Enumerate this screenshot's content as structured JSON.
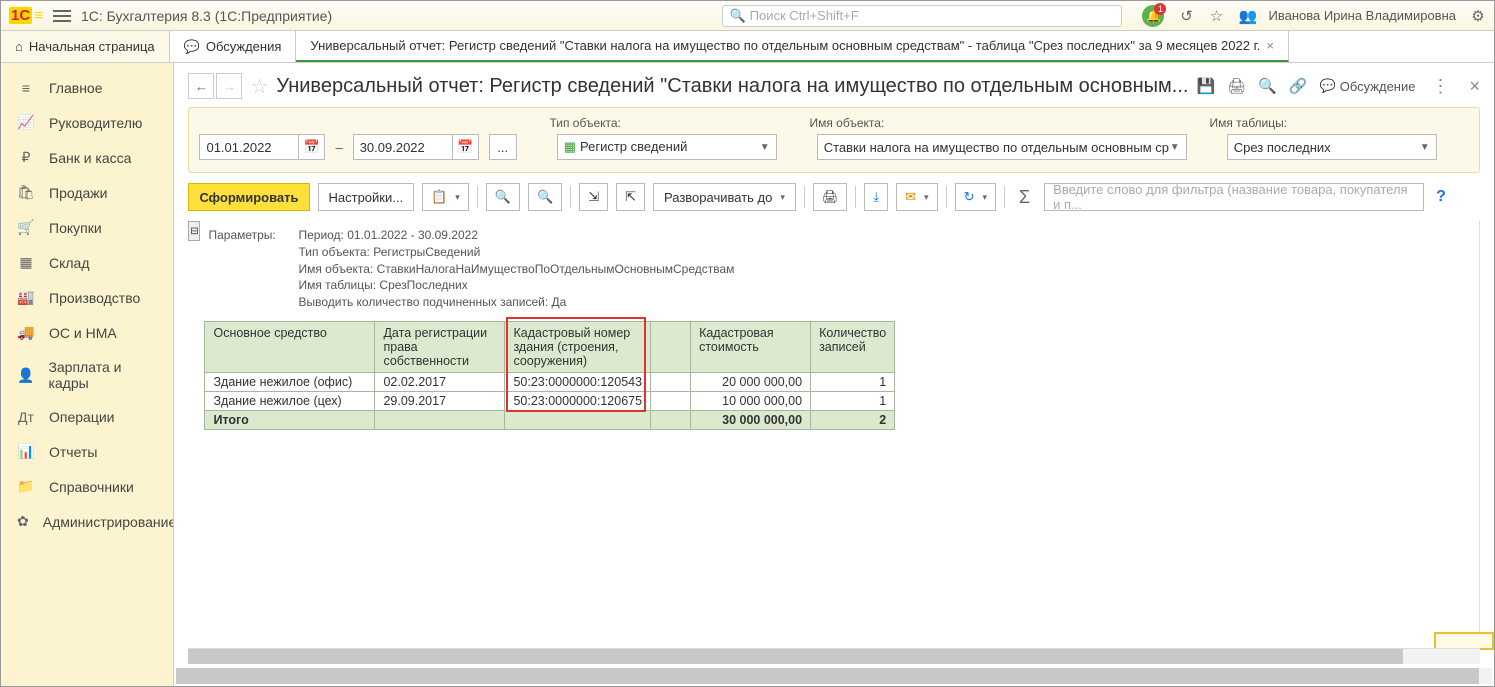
{
  "titlebar": {
    "app_title": "1С: Бухгалтерия 8.3  (1С:Предприятие)",
    "search_placeholder": "Поиск Ctrl+Shift+F",
    "bell_badge": "1",
    "user_name": "Иванова Ирина Владимировна"
  },
  "tabs": {
    "home": "Начальная страница",
    "discuss": "Обсуждения",
    "active": "Универсальный отчет: Регистр сведений \"Ставки налога на имущество по отдельным основным средствам\" - таблица \"Срез последних\" за 9 месяцев 2022 г."
  },
  "sidebar": [
    {
      "icon": "≡",
      "label": "Главное"
    },
    {
      "icon": "📈",
      "label": "Руководителю"
    },
    {
      "icon": "₽",
      "label": "Банк и касса"
    },
    {
      "icon": "🛍",
      "label": "Продажи"
    },
    {
      "icon": "🛒",
      "label": "Покупки"
    },
    {
      "icon": "▦",
      "label": "Склад"
    },
    {
      "icon": "🏭",
      "label": "Производство"
    },
    {
      "icon": "🚚",
      "label": "ОС и НМА"
    },
    {
      "icon": "👤",
      "label": "Зарплата и кадры"
    },
    {
      "icon": "Дт",
      "label": "Операции"
    },
    {
      "icon": "📊",
      "label": "Отчеты"
    },
    {
      "icon": "📁",
      "label": "Справочники"
    },
    {
      "icon": "✿",
      "label": "Администрирование"
    }
  ],
  "header": {
    "title": "Универсальный отчет: Регистр сведений \"Ставки налога на имущество по отдельным основным...",
    "discuss": "Обсуждение"
  },
  "filter": {
    "lbl_type": "Тип объекта:",
    "lbl_obj": "Имя объекта:",
    "lbl_tbl": "Имя таблицы:",
    "date_from": "01.01.2022",
    "date_to": "30.09.2022",
    "dash": "–",
    "dots": "...",
    "type_value": "Регистр сведений",
    "obj_value": "Ставки налога на имущество по отдельным основным ср",
    "tbl_value": "Срез последних"
  },
  "toolbar": {
    "form": "Сформировать",
    "settings": "Настройки...",
    "expand": "Разворачивать до",
    "filter_placeholder": "Введите слово для фильтра (название товара, покупателя и п...",
    "sigma": "Σ"
  },
  "params": {
    "label": "Параметры:",
    "period": "Период: 01.01.2022 - 30.09.2022",
    "type": "Тип объекта: РегистрыСведений",
    "obj": "Имя объекта: СтавкиНалогаНаИмуществоПоОтдельнымОсновнымСредствам",
    "tbl": "Имя таблицы: СрезПоследних",
    "count": "Выводить количество подчиненных записей: Да"
  },
  "table": {
    "headers": {
      "os": "Основное средство",
      "date": "Дата регистрации права собственности",
      "kad": "Кадастровый номер здания (строения, сооружения)",
      "empty": "",
      "cost": "Кадастровая стоимость",
      "cnt": "Количество записей"
    },
    "rows": [
      {
        "os": "Здание нежилое (офис)",
        "date": "02.02.2017",
        "kad": "50:23:0000000:120543",
        "cost": "20 000 000,00",
        "cnt": "1"
      },
      {
        "os": "Здание нежилое (цех)",
        "date": "29.09.2017",
        "kad": "50:23:0000000:120675",
        "cost": "10 000 000,00",
        "cnt": "1"
      }
    ],
    "total": {
      "label": "Итого",
      "cost": "30 000 000,00",
      "cnt": "2"
    }
  }
}
